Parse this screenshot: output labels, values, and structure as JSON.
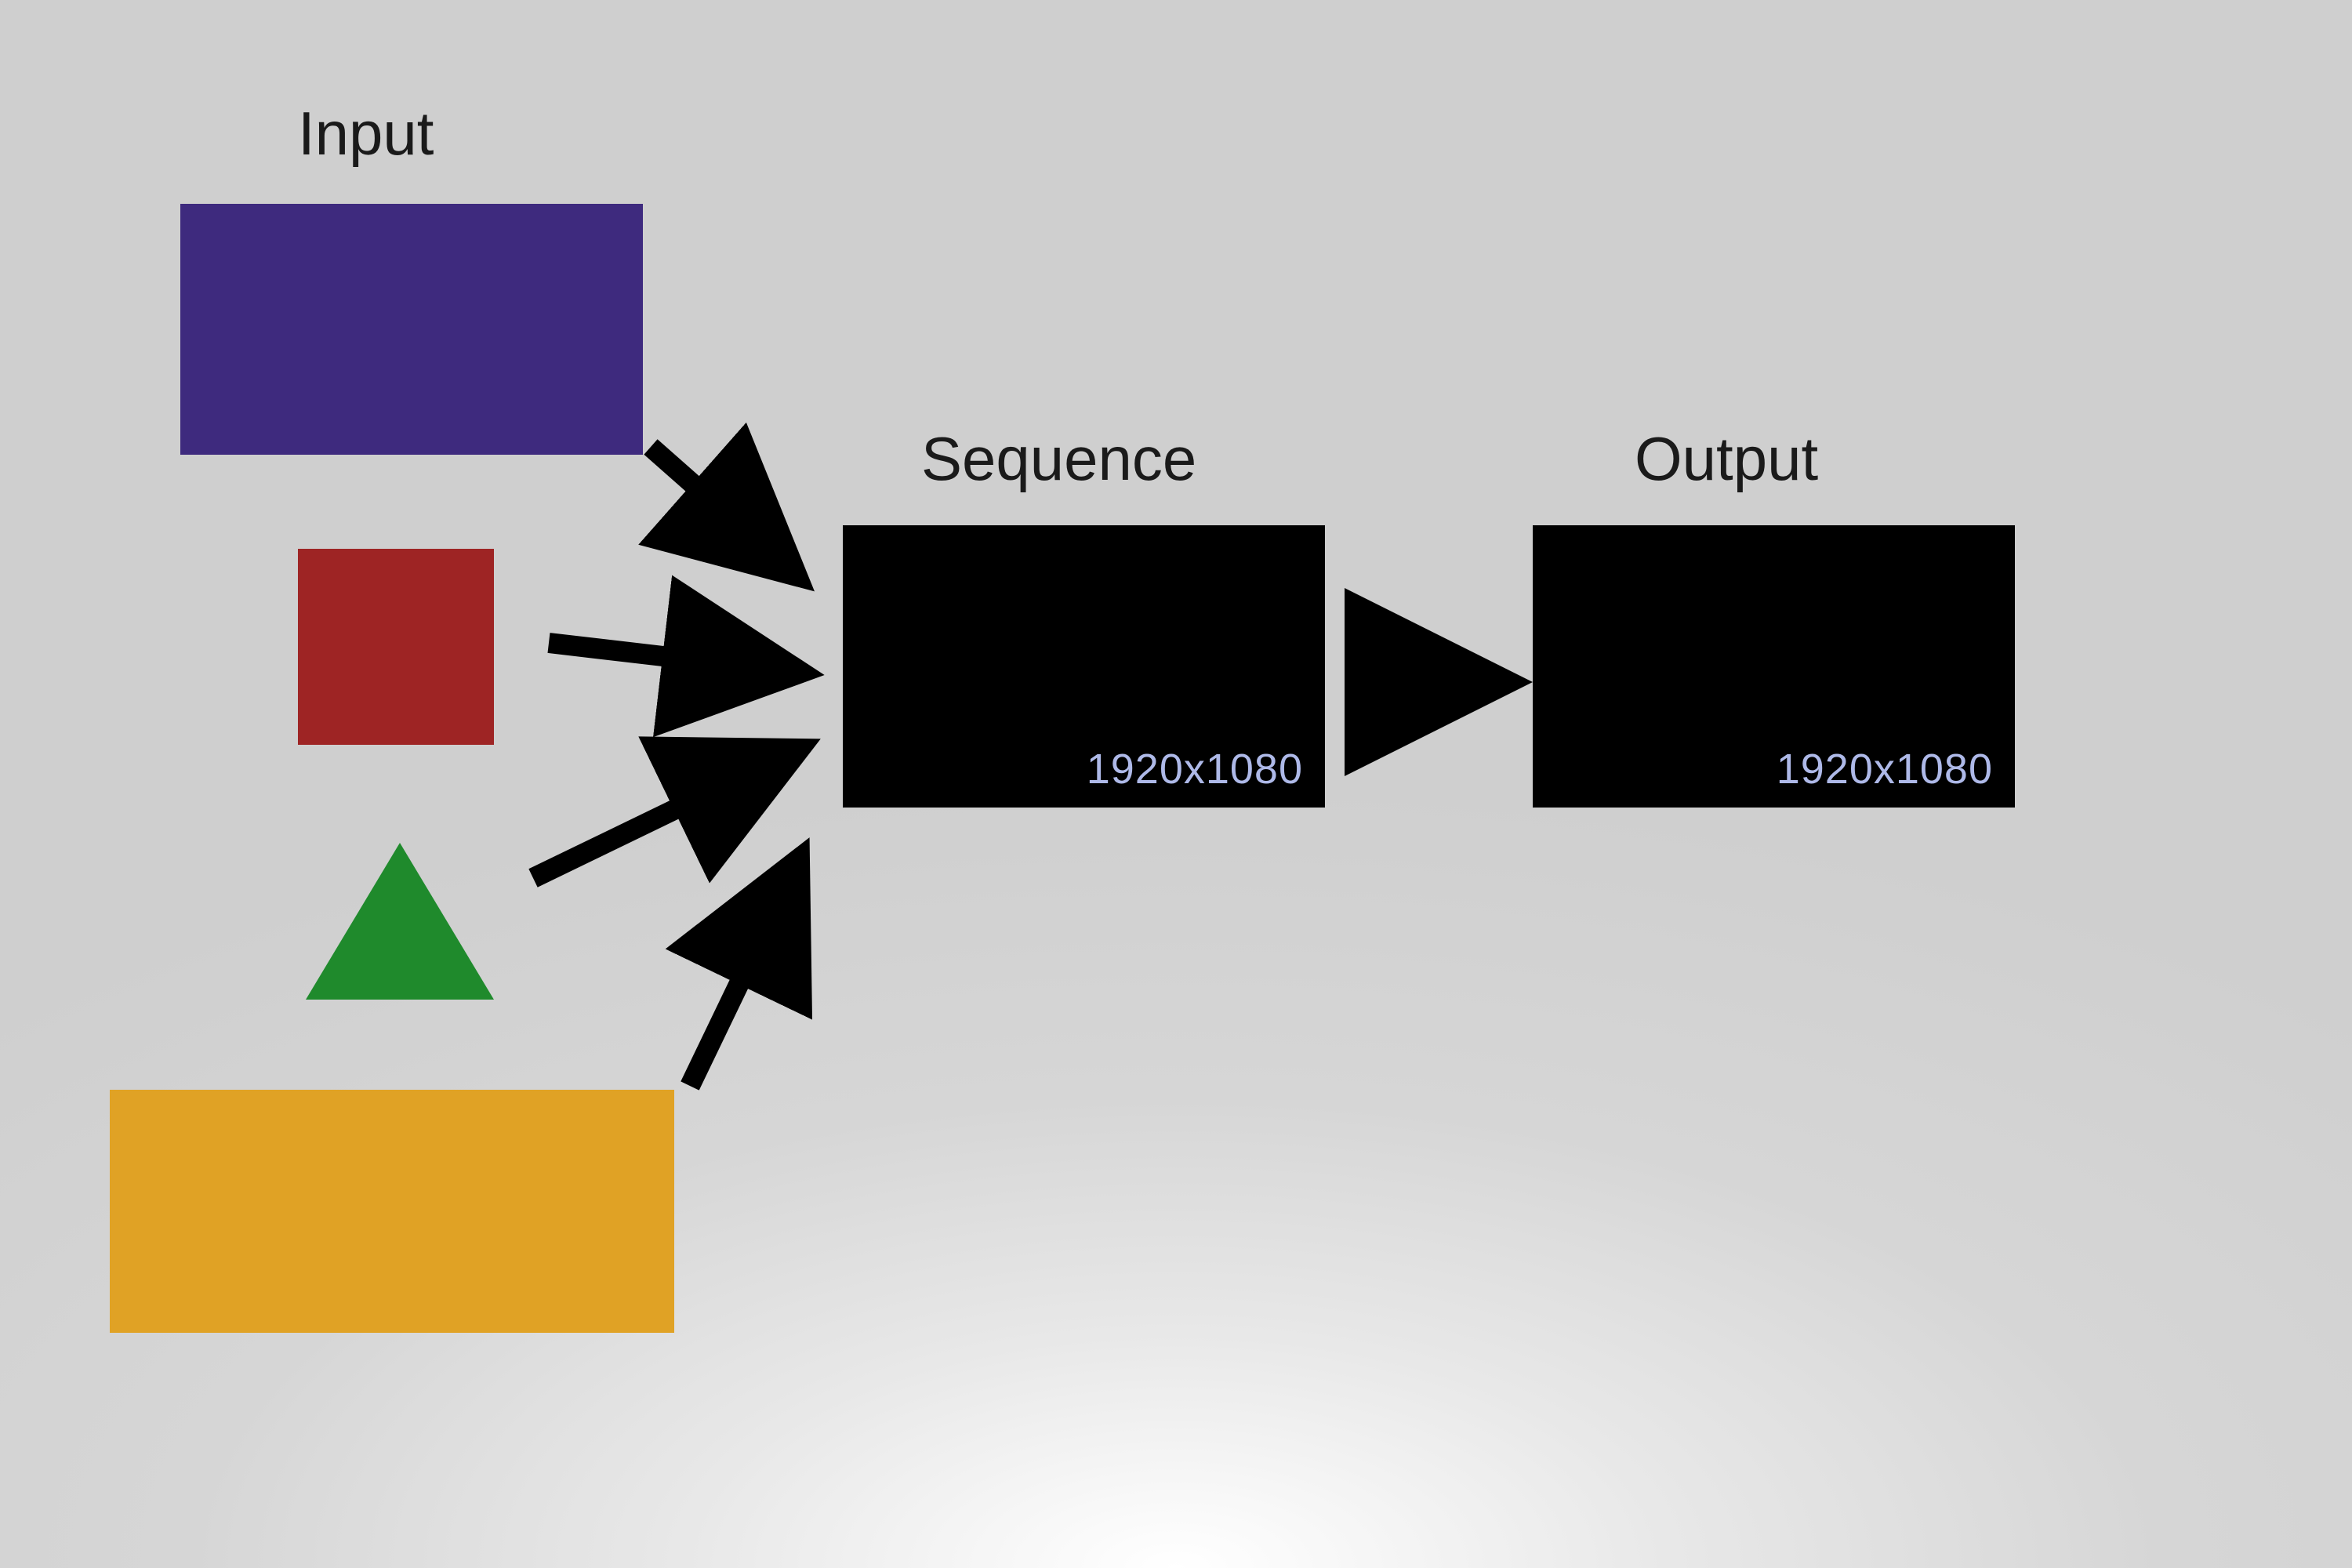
{
  "labels": {
    "input": "Input",
    "sequence": "Sequence",
    "output": "Output"
  },
  "sequence_box": {
    "resolution": "1920x1080"
  },
  "output_box": {
    "resolution": "1920x1080"
  },
  "colors": {
    "purple": "#3e2a7e",
    "red": "#9e2424",
    "green": "#1f8a2c",
    "yellow": "#e0a225",
    "black": "#000000",
    "resolution_text": "#aeb9e8"
  },
  "input_shapes": [
    {
      "name": "purple-rectangle",
      "type": "rect",
      "color": "purple"
    },
    {
      "name": "red-square",
      "type": "square",
      "color": "red"
    },
    {
      "name": "green-triangle",
      "type": "triangle",
      "color": "green"
    },
    {
      "name": "yellow-rectangle",
      "type": "rect",
      "color": "yellow"
    }
  ]
}
